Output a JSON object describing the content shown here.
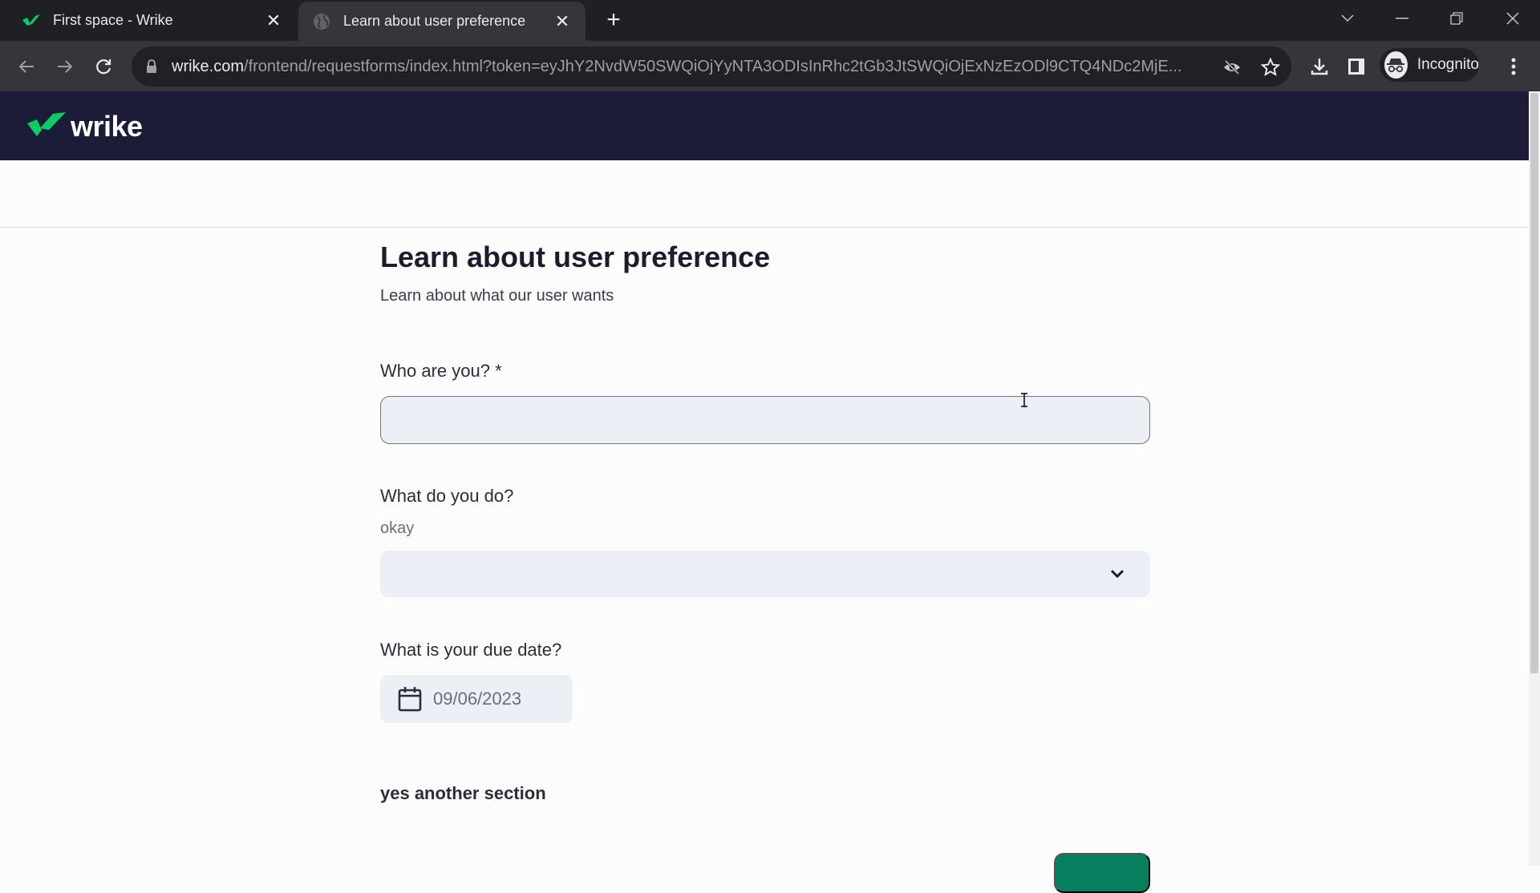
{
  "browser": {
    "tabs": [
      {
        "title": "First space - Wrike",
        "icon": "wrike-check-icon",
        "active": false
      },
      {
        "title": "Learn about user preference",
        "icon": "globe-icon",
        "active": true
      }
    ],
    "new_tab_label": "+",
    "url_host": "wrike.com",
    "url_path": "/frontend/requestforms/index.html?token=eyJhY2NvdW50SWQiOjYyNTA3ODIsInRhc2tGb3JtSWQiOjExNzEzODl9CTQ4NDc2MjE...",
    "profile_label": "Incognito",
    "colors": {
      "tabbar": "#1f2023",
      "toolbar": "#35363a",
      "omnibox": "#202124"
    }
  },
  "app": {
    "brand": "wrike",
    "colors": {
      "header": "#1b1d38",
      "logo_green": "#08cf65",
      "primary_button": "#067f5e",
      "field_bg": "#eceff6"
    }
  },
  "form": {
    "title": "Learn about user preference",
    "description": "Learn about what our user wants",
    "fields": [
      {
        "label": "Who are you? *",
        "type": "text",
        "value": "",
        "required": true
      },
      {
        "label": "What do you do?",
        "hint": "okay",
        "type": "select",
        "value": ""
      },
      {
        "label": "What is your due date?",
        "type": "date",
        "value": "09/06/2023"
      }
    ],
    "section_title": "yes another section",
    "submit_label": ""
  }
}
